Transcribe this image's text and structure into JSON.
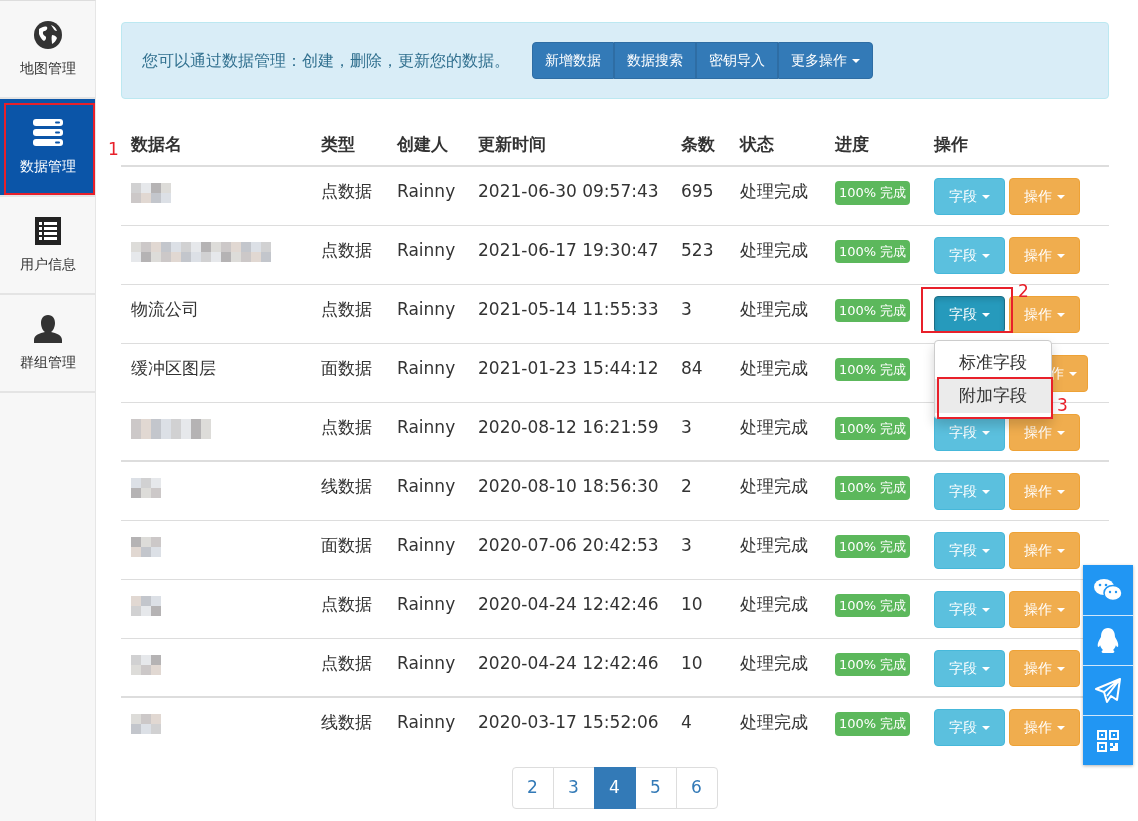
{
  "sidebar": {
    "items": [
      {
        "label": "地图管理",
        "selected": false
      },
      {
        "label": "数据管理",
        "selected": true,
        "annotation": "1"
      },
      {
        "label": "用户信息",
        "selected": false
      },
      {
        "label": "群组管理",
        "selected": false
      }
    ]
  },
  "notice": {
    "text": "您可以通过数据管理：创建，删除，更新您的数据。",
    "buttons": [
      {
        "label": "新增数据",
        "caret": false
      },
      {
        "label": "数据搜索",
        "caret": false
      },
      {
        "label": "密钥导入",
        "caret": false
      },
      {
        "label": "更多操作",
        "caret": true
      }
    ]
  },
  "table": {
    "columns": [
      "数据名",
      "类型",
      "创建人",
      "更新时间",
      "条数",
      "状态",
      "进度",
      "操作"
    ],
    "rows": [
      {
        "name_redacted": true,
        "type": "点数据",
        "creator": "Rainny",
        "updated": "2021-06-30 09:57:43",
        "count": "695",
        "status": "处理完成",
        "progress": "100% 完成",
        "field_button": "字段",
        "op_button": "操作"
      },
      {
        "name_redacted": true,
        "type": "点数据",
        "creator": "Rainny",
        "updated": "2021-06-17 19:30:47",
        "count": "523",
        "status": "处理完成",
        "progress": "100% 完成",
        "field_button": "字段",
        "op_button": "操作"
      },
      {
        "name": "物流公司",
        "name_redacted": false,
        "type": "点数据",
        "creator": "Rainny",
        "updated": "2021-05-14 11:55:33",
        "count": "3",
        "status": "处理完成",
        "progress": "100% 完成",
        "field_button": "字段",
        "field_open": true,
        "annotation": "2",
        "menu": [
          {
            "label": "标准字段",
            "selected": false
          },
          {
            "label": "附加字段",
            "selected": true,
            "annotation": "3"
          }
        ],
        "op_button": "操作"
      },
      {
        "name": "缓冲区图层",
        "name_redacted": false,
        "type": "面数据",
        "creator": "Rainny",
        "updated": "2021-01-23 15:44:12",
        "count": "84",
        "status": "处理完成",
        "progress": "100% 完成",
        "op_button": "作"
      },
      {
        "name_redacted": true,
        "type": "点数据",
        "creator": "Rainny",
        "updated": "2020-08-12 16:21:59",
        "count": "3",
        "status": "处理完成",
        "progress": "100% 完成",
        "field_button": "字段",
        "op_button": "操作"
      },
      {
        "name_redacted": true,
        "type": "线数据",
        "creator": "Rainny",
        "updated": "2020-08-10 18:56:30",
        "count": "2",
        "status": "处理完成",
        "progress": "100% 完成",
        "field_button": "字段",
        "op_button": "操作"
      },
      {
        "name_redacted": true,
        "type": "面数据",
        "creator": "Rainny",
        "updated": "2020-07-06 20:42:53",
        "count": "3",
        "status": "处理完成",
        "progress": "100% 完成",
        "field_button": "字段",
        "op_button": "操作"
      },
      {
        "name_redacted": true,
        "type": "点数据",
        "creator": "Rainny",
        "updated": "2020-04-24 12:42:46",
        "count": "10",
        "status": "处理完成",
        "progress": "100% 完成",
        "field_button": "字段",
        "op_button": "操作"
      },
      {
        "name_redacted": true,
        "type": "点数据",
        "creator": "Rainny",
        "updated": "2020-04-24 12:42:46",
        "count": "10",
        "status": "处理完成",
        "progress": "100% 完成",
        "field_button": "字段",
        "op_button": "操作"
      },
      {
        "name_redacted": true,
        "type": "线数据",
        "creator": "Rainny",
        "updated": "2020-03-17 15:52:06",
        "count": "4",
        "status": "处理完成",
        "progress": "100% 完成",
        "field_button": "字段",
        "op_button": "操作"
      }
    ]
  },
  "pagination": [
    {
      "label": "2",
      "selected": false
    },
    {
      "label": "3",
      "selected": false
    },
    {
      "label": "4",
      "selected": true
    },
    {
      "label": "5",
      "selected": false
    },
    {
      "label": "6",
      "selected": false
    }
  ],
  "float_bar": [
    {
      "kind": "chat"
    },
    {
      "kind": "penguin"
    },
    {
      "kind": "plane"
    },
    {
      "kind": "qr"
    }
  ]
}
